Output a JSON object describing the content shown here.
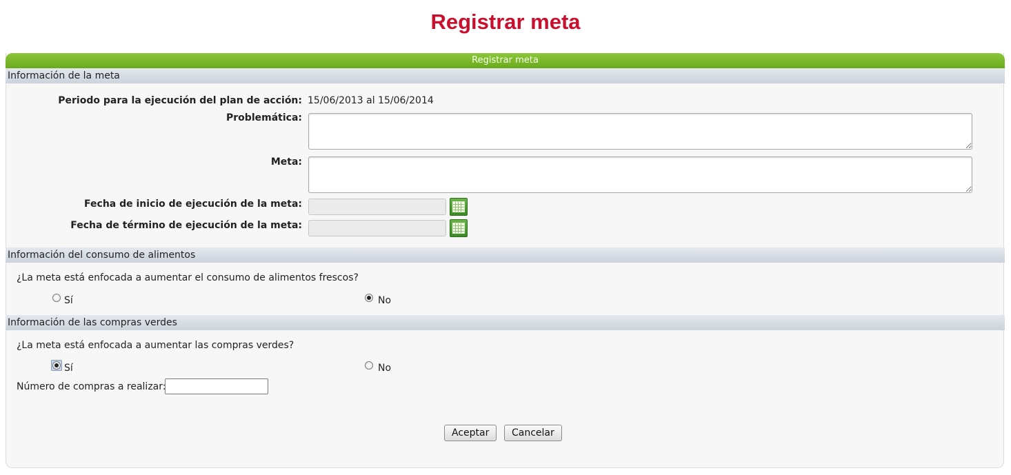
{
  "page": {
    "title": "Registrar meta"
  },
  "panel": {
    "header": "Registrar meta"
  },
  "sections": {
    "meta_info": "Información de la meta",
    "consumo": "Información del consumo de alimentos",
    "compras": "Información de las compras verdes"
  },
  "meta_form": {
    "periodo_label": "Periodo para la ejecución del plan de acción:",
    "periodo_value": "15/06/2013 al 15/06/2014",
    "problematica_label": "Problemática:",
    "problematica_value": "",
    "meta_label": "Meta:",
    "meta_value": "",
    "fecha_inicio_label": "Fecha de inicio de ejecución de la meta:",
    "fecha_inicio_value": "",
    "fecha_termino_label": "Fecha de término de ejecución de la meta:",
    "fecha_termino_value": ""
  },
  "consumo_form": {
    "question": "¿La meta está enfocada a aumentar el consumo de alimentos frescos?",
    "options": [
      {
        "label": "Sí",
        "selected": false
      },
      {
        "label": "No",
        "selected": true
      }
    ]
  },
  "compras_form": {
    "question": "¿La meta está enfocada a aumentar las compras verdes?",
    "options": [
      {
        "label": "Sí",
        "selected": true
      },
      {
        "label": "No",
        "selected": false
      }
    ],
    "numero_label": "Número de compras a realizar:",
    "numero_value": ""
  },
  "buttons": {
    "accept": "Aceptar",
    "cancel": "Cancelar"
  },
  "icons": {
    "calendar": "calendar-icon"
  },
  "colors": {
    "title": "#c8102e",
    "header": "#7ab82a"
  }
}
